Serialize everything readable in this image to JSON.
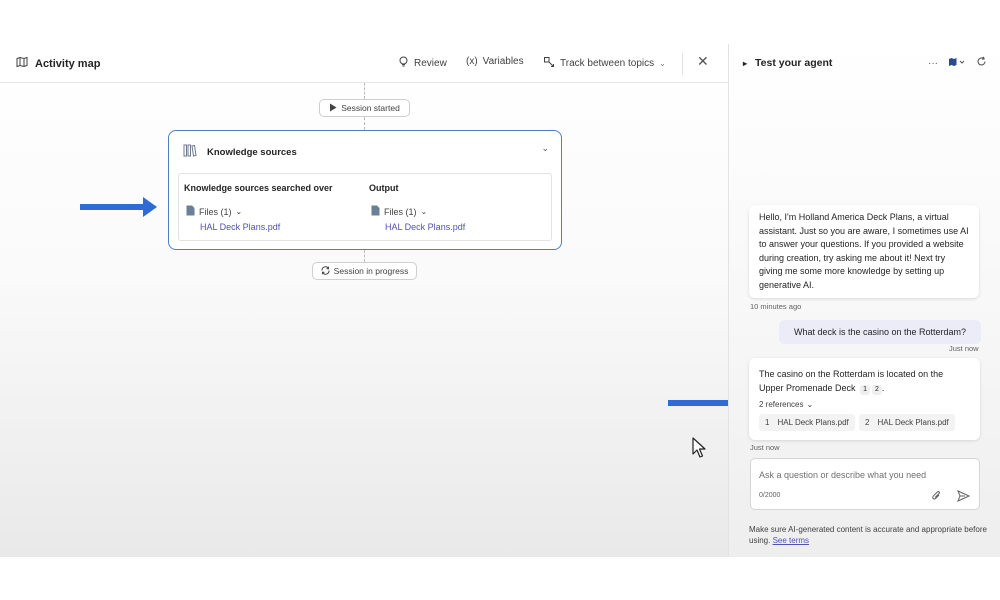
{
  "activity_map": {
    "title": "Activity map",
    "toolbar": {
      "review": "Review",
      "variables": "Variables",
      "track": "Track between topics",
      "close": "✕"
    },
    "session_started": "Session started",
    "session_in_progress": "Session in progress",
    "knowledge_card": {
      "title": "Knowledge sources",
      "searched_header": "Knowledge sources searched over",
      "output_header": "Output",
      "searched_files": "Files (1)",
      "searched_file_name": "HAL Deck Plans.pdf",
      "output_files": "Files (1)",
      "output_file_name": "HAL Deck Plans.pdf"
    }
  },
  "test_panel": {
    "title": "Test your agent",
    "more": "···",
    "greeting": "Hello, I'm Holland America Deck Plans, a virtual assistant. Just so you are aware, I sometimes use AI to answer your questions. If you provided a website during creation, try asking me about it! Next try giving me some more knowledge by setting up generative AI.",
    "greeting_time": "10 minutes ago",
    "user_message": "What deck is the casino on the Rotterdam?",
    "user_time": "Just now",
    "answer_text": "The casino on the Rotterdam is located on the Upper Promenade Deck",
    "cite_1": "1",
    "cite_2": "2",
    "answer_end": ".",
    "references_toggle": "2 references",
    "references": [
      {
        "num": "1",
        "name": "HAL Deck Plans.pdf"
      },
      {
        "num": "2",
        "name": "HAL Deck Plans.pdf"
      }
    ],
    "answer_time": "Just now",
    "input_placeholder": "Ask a question or describe what you need",
    "char_count": "0/2000",
    "disclaimer": "Make sure AI-generated content is accurate and appropriate before using.",
    "see_terms": "See terms"
  },
  "colors": {
    "accent_arrow": "#2e6bd6",
    "card_border": "#4d7fc2",
    "link": "#4f52b2"
  }
}
